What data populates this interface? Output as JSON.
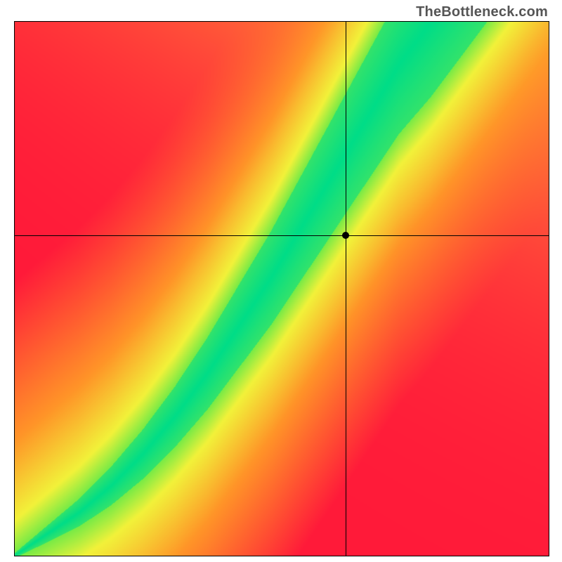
{
  "watermark": "TheBottleneck.com",
  "chart_data": {
    "type": "heatmap",
    "title": "",
    "xlabel": "",
    "ylabel": "",
    "xlim": [
      0,
      100
    ],
    "ylim": [
      0,
      100
    ],
    "grid": false,
    "legend": false,
    "crosshair": {
      "x": 62,
      "y": 60
    },
    "marker": {
      "x": 62,
      "y": 60
    },
    "ridge_path": [
      {
        "x": 0,
        "y": 0
      },
      {
        "x": 6,
        "y": 4
      },
      {
        "x": 12,
        "y": 8
      },
      {
        "x": 18,
        "y": 13
      },
      {
        "x": 24,
        "y": 19
      },
      {
        "x": 30,
        "y": 26
      },
      {
        "x": 36,
        "y": 34
      },
      {
        "x": 42,
        "y": 43
      },
      {
        "x": 48,
        "y": 52
      },
      {
        "x": 54,
        "y": 62
      },
      {
        "x": 60,
        "y": 72
      },
      {
        "x": 66,
        "y": 82
      },
      {
        "x": 72,
        "y": 92
      },
      {
        "x": 78,
        "y": 100
      }
    ],
    "ridge_width": {
      "start": 0.5,
      "end": 14
    },
    "background_corners": {
      "top_left": "#ff1a3a",
      "top_right": "#ffe733",
      "bottom_left": "#ff1a3a",
      "bottom_right": "#ff1a3a"
    },
    "yellow_halo_width": 8,
    "ridge_color": "#00dd88",
    "halo_color": "#f2f23a"
  }
}
